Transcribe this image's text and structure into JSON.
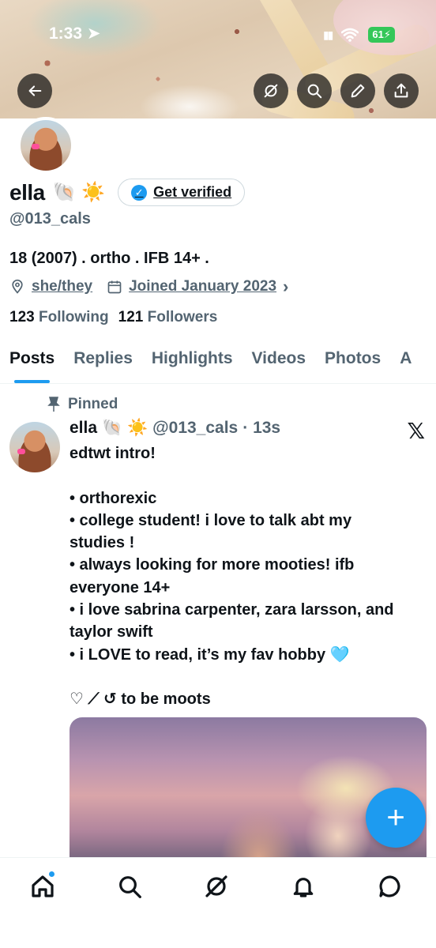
{
  "status_bar": {
    "time": "1:33",
    "battery": "61"
  },
  "profile": {
    "name": "ella",
    "name_emojis": "🐚 ☀️",
    "get_verified_label": "Get verified",
    "handle": "@013_cals",
    "bio": "18 (2007) . ortho . IFB 14+ .",
    "pronouns": "she/they",
    "joined": "Joined January 2023",
    "following_count": "123",
    "following_label": "Following",
    "followers_count": "121",
    "followers_label": "Followers"
  },
  "tabs": [
    "Posts",
    "Replies",
    "Highlights",
    "Videos",
    "Photos",
    "A"
  ],
  "post": {
    "pinned_label": "Pinned",
    "author_name": "ella",
    "author_emojis": "🐚 ☀️",
    "author_handle": "@013_cals",
    "time": "· 13s",
    "text": "edtwt intro!\n\n• orthorexic\n• college student! i love to talk abt my studies !\n• always looking for more mooties! ifb everyone 14+\n• i love sabrina carpenter, zara larsson, and taylor swift\n• i LOVE to read, it’s my fav hobby 🩵\n\n♡ ⟋ ↺ to be moots"
  },
  "fab_label": "+",
  "colors": {
    "accent": "#1d9bf0",
    "secondary_text": "#536471",
    "battery": "#34c759"
  },
  "icons": {
    "header": [
      "back-arrow-icon",
      "grok-icon",
      "search-icon",
      "pencil-icon",
      "share-icon"
    ],
    "nav": [
      "home-icon",
      "search-icon",
      "grok-icon",
      "bell-icon",
      "message-icon"
    ]
  }
}
